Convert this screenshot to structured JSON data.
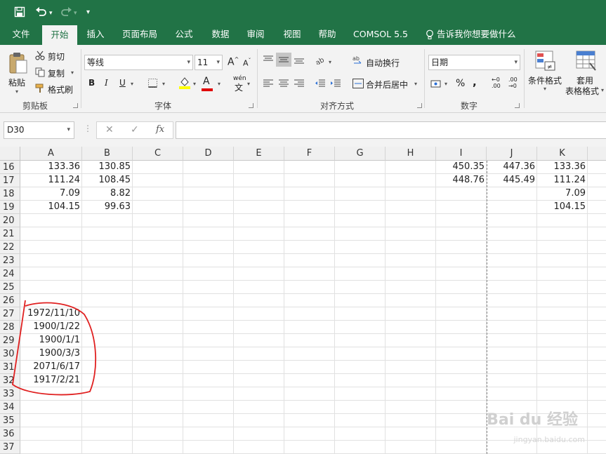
{
  "quick_access": {
    "save_icon": "save-icon",
    "undo_icon": "undo-icon",
    "redo_icon": "redo-icon",
    "customize_icon": "customize-icon"
  },
  "tabs": [
    "文件",
    "开始",
    "插入",
    "页面布局",
    "公式",
    "数据",
    "审阅",
    "视图",
    "帮助",
    "COMSOL 5.5",
    "告诉我你想要做什么"
  ],
  "active_tab": "开始",
  "ribbon": {
    "clipboard": {
      "paste": "粘贴",
      "cut": "剪切",
      "copy": "复制",
      "format_painter": "格式刷",
      "label": "剪贴板"
    },
    "font": {
      "name": "等线",
      "size": "11",
      "bold": "B",
      "italic": "I",
      "underline": "U",
      "phonetic": "wén",
      "label": "字体",
      "fill_color": "#ffff00",
      "font_color": "#e00000"
    },
    "alignment": {
      "wrap_text": "自动换行",
      "merge_center": "合并后居中",
      "label": "对齐方式"
    },
    "number": {
      "format": "日期",
      "percent": "%",
      "comma": ",",
      "inc_decimal": ".00",
      "dec_decimal": ".00",
      "label": "数字"
    },
    "styles": {
      "conditional": "条件格式",
      "table_format_1": "套用",
      "table_format_2": "表格格式"
    }
  },
  "formula_bar": {
    "name_box": "D30",
    "cancel": "✕",
    "enter": "✓",
    "fx": "fx",
    "value": ""
  },
  "columns": [
    "A",
    "B",
    "C",
    "D",
    "E",
    "F",
    "G",
    "H",
    "I",
    "J",
    "K"
  ],
  "rows": [
    {
      "num": "16",
      "cells": {
        "A": "133.36",
        "B": "130.85",
        "I": "450.35",
        "J": "447.36",
        "K": "133.36"
      }
    },
    {
      "num": "17",
      "cells": {
        "A": "111.24",
        "B": "108.45",
        "I": "448.76",
        "J": "445.49",
        "K": "111.24"
      }
    },
    {
      "num": "18",
      "cells": {
        "A": "7.09",
        "B": "8.82",
        "K": "7.09"
      }
    },
    {
      "num": "19",
      "cells": {
        "A": "104.15",
        "B": "99.63",
        "K": "104.15"
      }
    },
    {
      "num": "20",
      "cells": {}
    },
    {
      "num": "21",
      "cells": {}
    },
    {
      "num": "22",
      "cells": {}
    },
    {
      "num": "23",
      "cells": {}
    },
    {
      "num": "24",
      "cells": {}
    },
    {
      "num": "25",
      "cells": {}
    },
    {
      "num": "26",
      "cells": {}
    },
    {
      "num": "27",
      "cells": {
        "A": "1972/11/10"
      }
    },
    {
      "num": "28",
      "cells": {
        "A": "1900/1/22"
      }
    },
    {
      "num": "29",
      "cells": {
        "A": "1900/1/1"
      }
    },
    {
      "num": "30",
      "cells": {
        "A": "1900/3/3"
      }
    },
    {
      "num": "31",
      "cells": {
        "A": "2071/6/17"
      }
    },
    {
      "num": "32",
      "cells": {
        "A": "1917/2/21"
      }
    },
    {
      "num": "33",
      "cells": {}
    },
    {
      "num": "34",
      "cells": {}
    },
    {
      "num": "35",
      "cells": {}
    },
    {
      "num": "36",
      "cells": {}
    },
    {
      "num": "37",
      "cells": {}
    }
  ],
  "annotation_color": "#e02020",
  "watermark": {
    "main": "Bai du 经验",
    "sub": "jingyan.baidu.com"
  }
}
